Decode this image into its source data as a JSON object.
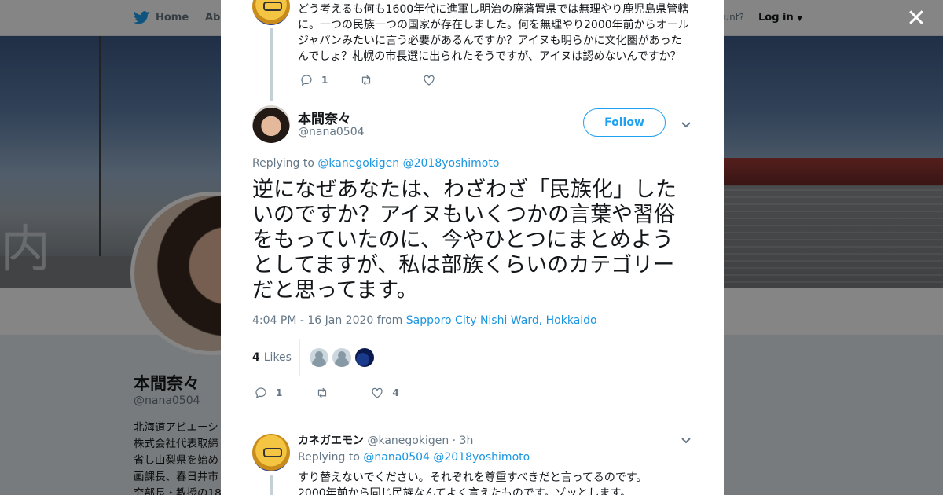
{
  "topbar": {
    "home_label": "Home",
    "about_label": "Abo",
    "account_text": "ccount?",
    "login_label": "Log in"
  },
  "banner": {
    "sign_text": "内"
  },
  "profile": {
    "name": "本間奈々",
    "handle": "@nana0504",
    "bio_lines": [
      "北海道アビエーシ",
      "株式会社代表取締",
      "省し山梨県を始め",
      "画課長、春日井市",
      "究部長・教授の18"
    ]
  },
  "previous_tweet": {
    "text": "どう考えるも何も1600年代に進軍し明治の廃藩置県では無理やり鹿児島県管轄に。一つの民族一つの国家が存在しました。何を無理やり2000年前からオールジャパンみたいに言う必要があるんですか？アイヌも明らかに文化圏があったんでしょ？札幌の市長選に出られたそうですが、アイヌは認めないんですか？",
    "reply_count": "1"
  },
  "main_tweet": {
    "name": "本間奈々",
    "handle": "@nana0504",
    "follow_label": "Follow",
    "replying_prefix": "Replying to",
    "replying_to_1": "@kanegokigen",
    "replying_to_2": "@2018yoshimoto",
    "text": "逆になぜあなたは、わざわざ「民族化」したいのですか？アイヌもいくつかの言葉や習俗をもっていたのに、今やひとつにまとめようとしてますが、私は部族くらいのカテゴリーだと思ってます。",
    "timestamp": "4:04 PM - 16 Jan 2020 from",
    "location": "Sapporo City Nishi Ward, Hokkaido",
    "likes_count": "4",
    "likes_label": "Likes",
    "reply_count": "1",
    "like_count": "4"
  },
  "reply_tweet": {
    "name": "カネガエモン",
    "handle": "@kanegokigen",
    "time": "· 3h",
    "replying_prefix": "Replying to",
    "replying_to_1": "@nana0504",
    "replying_to_2": "@2018yoshimoto",
    "text_line1": "すり替えないでください。それぞれを尊重すべきだと言ってるのです。",
    "text_line2": "2000年前から同じ民族なんてよく言えたものです。ゾッとします。"
  },
  "colors": {
    "accent": "#1da1f2",
    "link": "#1b95e0",
    "secondary_text": "#657786",
    "overlay": "rgba(0,0,0,0.48)"
  }
}
